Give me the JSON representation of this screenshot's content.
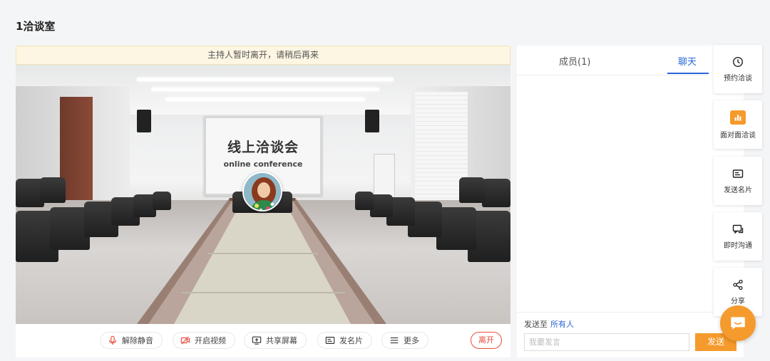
{
  "room": {
    "title": "1洽谈室"
  },
  "notice": {
    "text": "主持人暂时离开，请稍后再来"
  },
  "scene": {
    "screen_title": "线上洽谈会",
    "screen_subtitle": "online conference"
  },
  "toolbar": {
    "buttons": [
      {
        "label": "解除静音",
        "icon": "mic-icon"
      },
      {
        "label": "开启视频",
        "icon": "video-off-icon"
      },
      {
        "label": "共享屏幕",
        "icon": "share-screen-icon"
      },
      {
        "label": "发名片",
        "icon": "card-icon"
      },
      {
        "label": "更多",
        "icon": "menu-icon"
      }
    ],
    "leave_label": "离开"
  },
  "side": {
    "tabs": [
      {
        "label": "成员(1)",
        "active": false
      },
      {
        "label": "聊天",
        "active": true
      }
    ],
    "send_to_label": "发送至",
    "send_to_target": "所有人",
    "input_placeholder": "我要发言",
    "send_label": "发送"
  },
  "rail": [
    {
      "label": "预约洽谈",
      "icon": "clock-icon"
    },
    {
      "label": "面对面洽谈",
      "icon": "bar-chart-icon"
    },
    {
      "label": "发送名片",
      "icon": "card-icon"
    },
    {
      "label": "即时沟通",
      "icon": "chat-icon"
    },
    {
      "label": "分享",
      "icon": "share-icon"
    }
  ],
  "colors": {
    "accent": "#f59a2c",
    "link": "#2b66d9",
    "danger": "#e84c3d"
  }
}
